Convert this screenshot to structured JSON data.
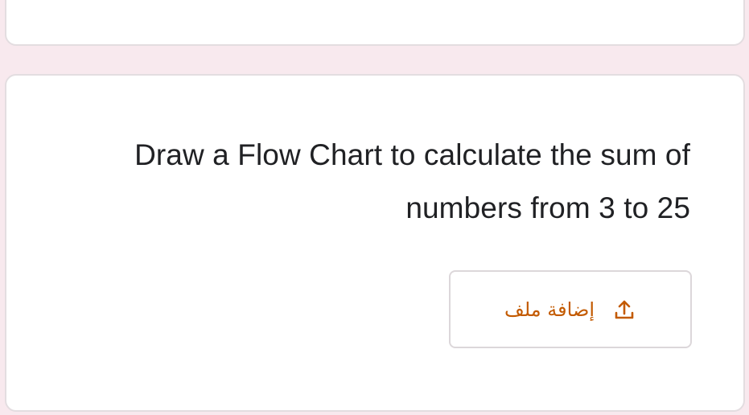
{
  "question": {
    "text": "Draw a Flow Chart to calculate the sum of numbers from 3 to 25"
  },
  "upload": {
    "label": "إضافة ملف",
    "icon": "upload-icon"
  },
  "colors": {
    "background": "#f8e9ee",
    "card": "#ffffff",
    "accent": "#c35a00",
    "text": "#202124"
  }
}
